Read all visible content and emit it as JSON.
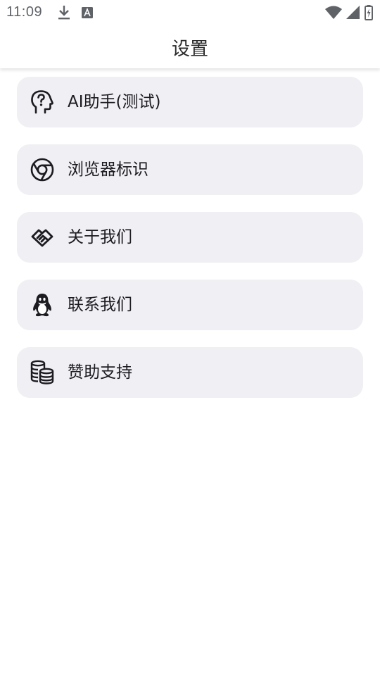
{
  "status_bar": {
    "time": "11:09",
    "left_icons": [
      "download-icon",
      "font-a-icon"
    ],
    "right_icons": [
      "wifi-icon",
      "cell-signal-icon",
      "battery-charging-icon"
    ]
  },
  "app_bar": {
    "title": "设置"
  },
  "settings": {
    "items": [
      {
        "label": "AI助手(测试)",
        "icon": "ai-head-question-icon"
      },
      {
        "label": "浏览器标识",
        "icon": "chrome-icon"
      },
      {
        "label": "关于我们",
        "icon": "handshake-icon"
      },
      {
        "label": "联系我们",
        "icon": "qq-penguin-icon"
      },
      {
        "label": "赞助支持",
        "icon": "coins-icon"
      }
    ]
  },
  "colors": {
    "card_background": "#f0eff4",
    "text": "#1c1b1f",
    "status_icon": "#5f6368"
  }
}
